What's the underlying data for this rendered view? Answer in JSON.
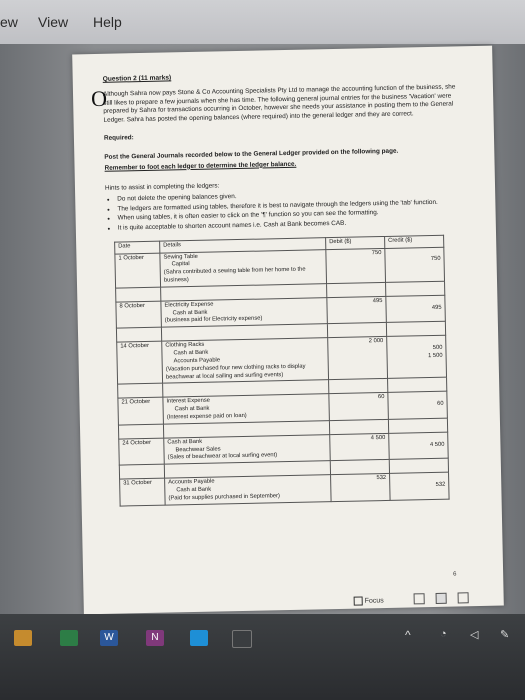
{
  "menu": {
    "left": "ew",
    "view": "View",
    "help": "Help"
  },
  "question": {
    "title": "Question 2 (11 marks)",
    "intro": "Although Sahra now pays Stone & Co Accounting Specialists Pty Ltd to manage the accounting function of the business, she still likes to prepare a few journals when she has time. The following general journal entries for the business 'Vacation' were prepared by Sahra for transactions occurring in October, however she needs your assistance in posting them to the General Ledger. Sahra has posted the opening balances (where required) into the general ledger and they are correct.",
    "required": "Required:",
    "post": "Post the General Journals recorded below to the General Ledger provided on the following page.",
    "remember": "Remember to foot each ledger to determine the ledger balance.",
    "hints_title": "Hints to assist in completing the ledgers:",
    "hints": [
      "Do not delete the opening balances given.",
      "The ledgers are formatted using tables, therefore it is best to navigate through the ledgers using the 'tab' function.",
      "When using tables, it is often easier to click on the '¶' function so you can see the formatting.",
      "It is quite acceptable to shorten account names i.e. Cash at Bank becomes CAB."
    ]
  },
  "table": {
    "headers": {
      "date": "Date",
      "details": "Details",
      "debit": "Debit ($)",
      "credit": "Credit ($)"
    },
    "entries": [
      {
        "date": "1 October",
        "dr_account": "Sewing Table",
        "cr_account": "Capital",
        "narration": "(Sahra contributed a sewing table from her home to the business)",
        "debit": "750",
        "credit": "750"
      },
      {
        "date": "8 October",
        "dr_account": "Electricity Expense",
        "cr_account": "Cash at Bank",
        "narration": "(business paid for Electricity expense)",
        "debit": "495",
        "credit": "495"
      },
      {
        "date": "14 October",
        "dr_account": "Clothing Racks",
        "cr_account": "Cash at Bank",
        "cr_account2": "Accounts Payable",
        "narration": "(Vacation purchased four new clothing racks to display beachwear at local sailing and surfing events)",
        "debit": "2 000",
        "credit": "500",
        "credit2": "1 500"
      },
      {
        "date": "21 October",
        "dr_account": "Interest Expense",
        "cr_account": "Cash at Bank",
        "narration": "(Interest expense paid on loan)",
        "debit": "60",
        "credit": "60"
      },
      {
        "date": "24 October",
        "dr_account": "Cash at Bank",
        "cr_account": "Beachwear Sales",
        "narration": "(Sales of beachwear at local surfing event)",
        "debit": "4 500",
        "credit": "4 500"
      },
      {
        "date": "31 October",
        "dr_account": "Accounts Payable",
        "cr_account": "Cash at Bank",
        "narration": "(Paid for supplies purchased in September)",
        "debit": "532",
        "credit": "532"
      }
    ]
  },
  "status": {
    "focus": "Focus",
    "page_marker": "6"
  },
  "taskbar": {
    "word_letter": "W",
    "onenote_letter": "N"
  },
  "colors": {
    "word": "#2b579a",
    "onenote": "#80397b",
    "edge": "#1e8fd6"
  }
}
